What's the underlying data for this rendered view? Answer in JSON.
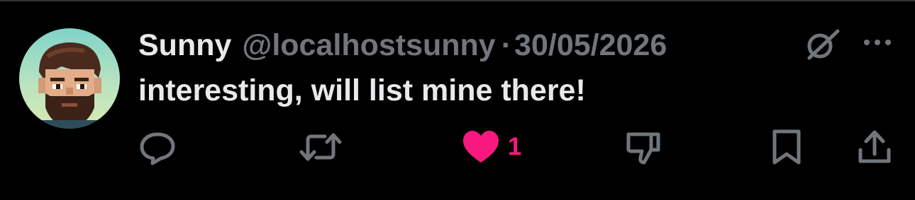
{
  "post": {
    "author_name": "Sunny",
    "author_handle": "@localhostsunny",
    "separator": "·",
    "date": "30/05/2026",
    "text": "interesting, will list mine there!"
  },
  "actions": {
    "reply": {
      "icon": "reply-icon"
    },
    "repost": {
      "icon": "repost-icon"
    },
    "like": {
      "icon": "heart-icon",
      "count": "1",
      "liked": true,
      "color": "#f91880"
    },
    "dislike": {
      "icon": "thumbs-down-icon"
    },
    "bookmark": {
      "icon": "bookmark-icon"
    },
    "share": {
      "icon": "share-icon"
    }
  },
  "header_icons": {
    "grok": "grok-icon",
    "more": "more-icon"
  },
  "colors": {
    "background": "#000000",
    "primary_text": "#e7e9ea",
    "secondary_text": "#71767b",
    "like": "#f91880"
  }
}
